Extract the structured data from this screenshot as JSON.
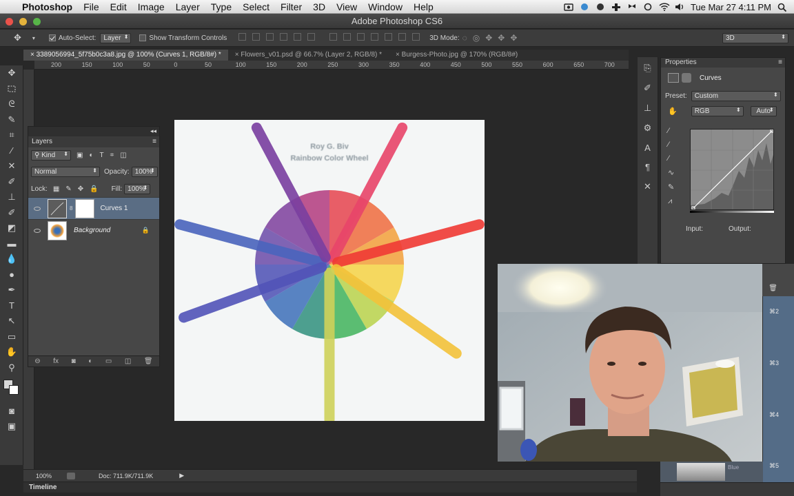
{
  "menubar": {
    "app_name": "Photoshop",
    "items": [
      "File",
      "Edit",
      "Image",
      "Layer",
      "Type",
      "Select",
      "Filter",
      "3D",
      "View",
      "Window",
      "Help"
    ],
    "datetime": "Tue Mar 27  4:11 PM"
  },
  "window": {
    "title": "Adobe Photoshop CS6"
  },
  "options": {
    "auto_select_label": "Auto-Select:",
    "auto_select_value": "Layer",
    "transform_label": "Show Transform Controls",
    "mode_3d_label": "3D Mode:",
    "workspace": "3D"
  },
  "tabs": [
    {
      "label": "3389056994_5f75b0c3a8.jpg @ 100% (Curves 1, RGB/8#) *"
    },
    {
      "label": "Flowers_v01.psd @ 66.7% (Layer 2, RGB/8) *"
    },
    {
      "label": "Burgess-Photo.jpg @ 170% (RGB/8#)"
    }
  ],
  "ruler_ticks": [
    "200",
    "150",
    "100",
    "50",
    "0",
    "50",
    "100",
    "150",
    "200",
    "250",
    "300",
    "350",
    "400",
    "450",
    "500",
    "550",
    "600",
    "650",
    "700"
  ],
  "canvas": {
    "line1": "Roy G. Biv",
    "line2": "Rainbow Color Wheel"
  },
  "layers_panel": {
    "title": "Layers",
    "filter": "Kind",
    "blend_mode": "Normal",
    "opacity_label": "Opacity:",
    "opacity_value": "100%",
    "lock_label": "Lock:",
    "fill_label": "Fill:",
    "fill_value": "100%",
    "layers": [
      {
        "name": "Curves 1"
      },
      {
        "name": "Background"
      }
    ]
  },
  "properties": {
    "title": "Properties",
    "adjustment": "Curves",
    "preset_label": "Preset:",
    "preset_value": "Custom",
    "channel": "RGB",
    "auto_label": "Auto",
    "input_label": "Input:",
    "output_label": "Output:"
  },
  "channel_shortcuts": [
    "⌘2",
    "⌘3",
    "⌘4",
    "⌘5"
  ],
  "channel_blue": "Blue",
  "status": {
    "zoom": "100%",
    "doc": "Doc: 711.9K/711.9K"
  },
  "timeline": {
    "label": "Timeline"
  },
  "colors": {
    "wedges": [
      "#e5434d",
      "#ee6b3d",
      "#f2a03a",
      "#f4d244",
      "#b9d24a",
      "#3fb35a",
      "#2f8f7d",
      "#3c6fb8",
      "#4b4fb4",
      "#6a4aa8",
      "#7c3e9c",
      "#b23a7e"
    ],
    "crayons": [
      "#e8456a",
      "#f03a35",
      "#f3c23a",
      "#cfd25a",
      "#4a64bd",
      "#5254b8",
      "#7a3fa0"
    ]
  }
}
